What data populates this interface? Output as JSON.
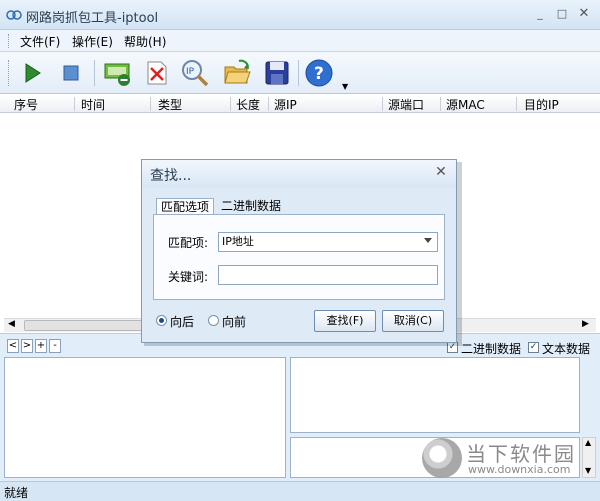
{
  "window": {
    "title": "网路岗抓包工具-iptool"
  },
  "menu": [
    "文件(F)",
    "操作(E)",
    "帮助(H)"
  ],
  "toolbar": {
    "icons": [
      "start-icon",
      "stop-icon",
      "network-icon",
      "delete-icon",
      "ip-search-icon",
      "open-folder-icon",
      "save-icon",
      "help-icon"
    ]
  },
  "table": {
    "columns": [
      "序号",
      "时间",
      "类型",
      "长度",
      "源IP",
      "源端口",
      "源MAC",
      "目的IP"
    ]
  },
  "bottom": {
    "nav": [
      "<",
      ">",
      "+",
      "-"
    ],
    "checkbox_binary": "二进制数据",
    "checkbox_text": "文本数据"
  },
  "status": {
    "text": "就绪"
  },
  "watermark": {
    "main": "当下软件园",
    "url": "www.downxia.com"
  },
  "dialog": {
    "title": "查找...",
    "tabs": [
      "匹配选项",
      "二进制数据"
    ],
    "match_label": "匹配项:",
    "match_value": "IP地址",
    "keyword_label": "关键词:",
    "keyword_value": "",
    "radio_back": "向后",
    "radio_forward": "向前",
    "find_button": "查找(F)",
    "cancel_button": "取消(C)"
  },
  "colors": {
    "accent": "#3a6ea5",
    "dialog_bg": "#dfeaf7",
    "panel_bg": "#e1edf9"
  }
}
